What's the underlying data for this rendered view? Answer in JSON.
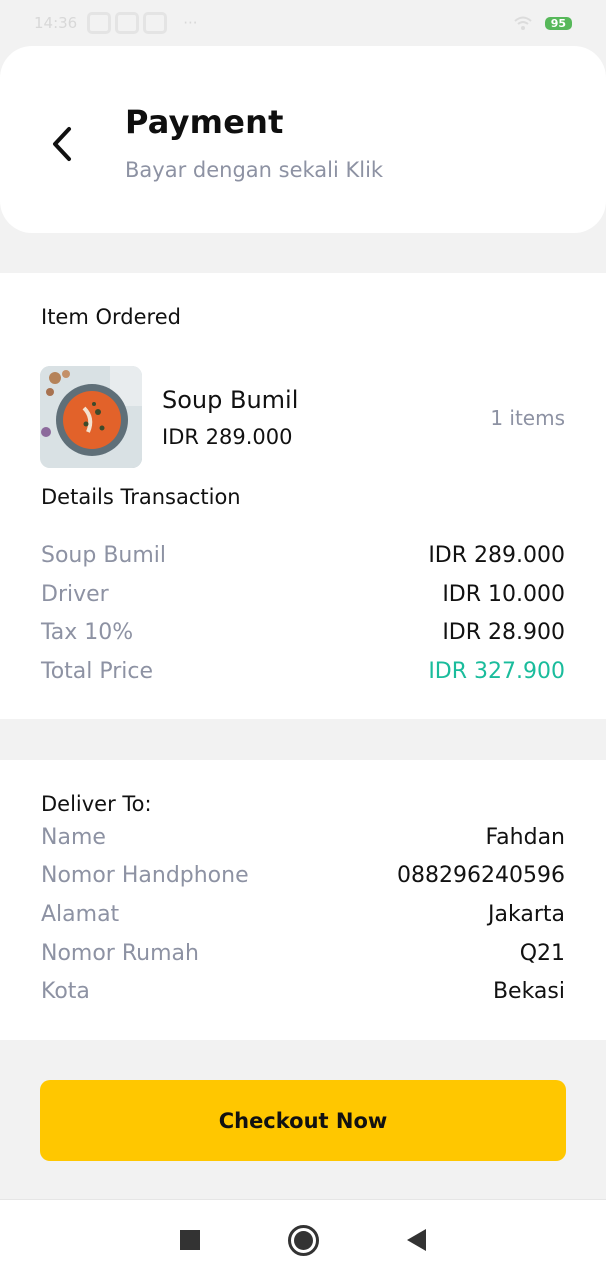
{
  "status_bar": {
    "time": "14:36",
    "battery": "95",
    "icons": [
      "notification-icon",
      "notification-icon",
      "notification-icon",
      "more-icon",
      "wifi-icon",
      "battery-icon"
    ]
  },
  "header": {
    "title": "Payment",
    "subtitle": "Bayar dengan sekali Klik",
    "back_icon": "chevron-left-icon"
  },
  "order": {
    "section_title": "Item Ordered",
    "item": {
      "name": "Soup Bumil",
      "price": "IDR 289.000",
      "quantity": "1 items"
    }
  },
  "transaction": {
    "section_title": "Details Transaction",
    "rows": [
      {
        "label": "Soup Bumil",
        "value": "IDR 289.000"
      },
      {
        "label": "Driver",
        "value": "IDR 10.000"
      },
      {
        "label": "Tax 10%",
        "value": "IDR 28.900"
      },
      {
        "label": "Total Price",
        "value": "IDR 327.900"
      }
    ]
  },
  "deliver": {
    "section_title": "Deliver To:",
    "rows": [
      {
        "label": "Name",
        "value": "Fahdan"
      },
      {
        "label": "Nomor Handphone",
        "value": "088296240596"
      },
      {
        "label": "Alamat",
        "value": "Jakarta"
      },
      {
        "label": "Nomor Rumah",
        "value": "Q21"
      },
      {
        "label": "Kota",
        "value": "Bekasi"
      }
    ]
  },
  "checkout": {
    "label": "Checkout Now"
  },
  "colors": {
    "accent_yellow": "#ffc700",
    "total_price": "#1abc9c",
    "muted_text": "#8d92a3"
  },
  "nav_bar": {
    "icons": [
      "recent-apps-icon",
      "home-icon",
      "back-icon"
    ]
  }
}
